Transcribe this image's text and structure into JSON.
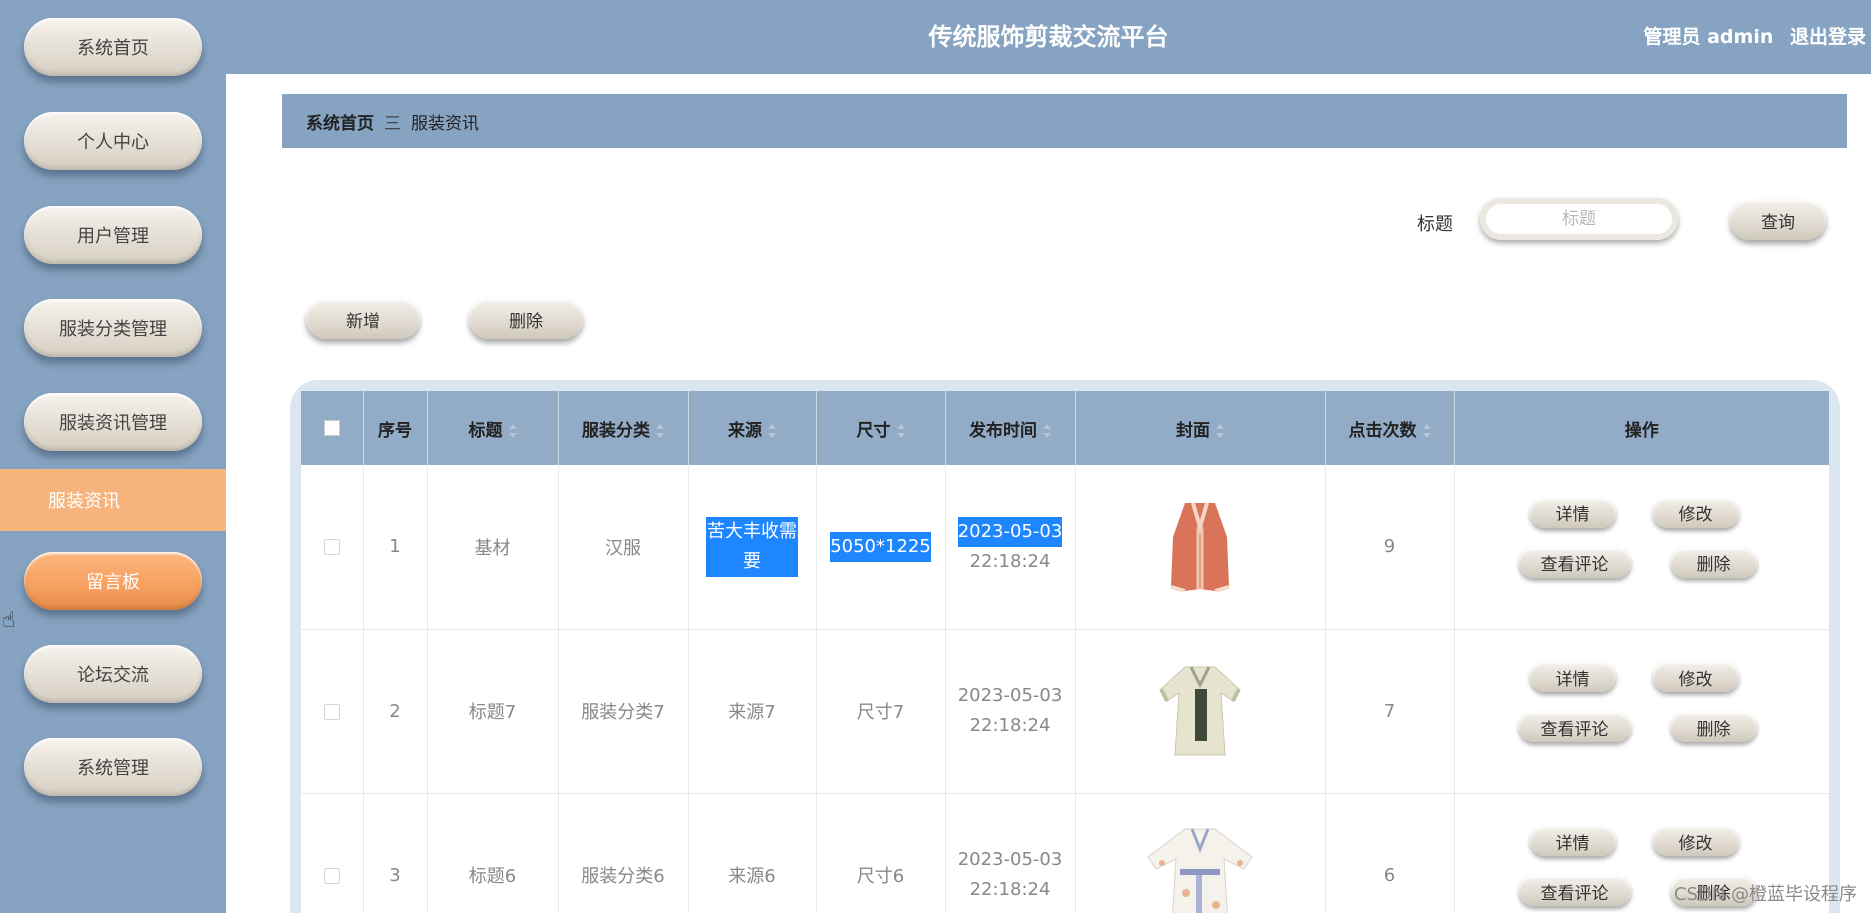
{
  "sidebar": {
    "items": [
      {
        "label": "系统首页"
      },
      {
        "label": "个人中心"
      },
      {
        "label": "用户管理"
      },
      {
        "label": "服装分类管理"
      },
      {
        "label": "服装资讯管理"
      }
    ],
    "active_item": {
      "label": "服装资讯"
    },
    "highlight_item": {
      "label": "留言板"
    },
    "items_after": [
      {
        "label": "论坛交流"
      },
      {
        "label": "系统管理"
      }
    ]
  },
  "header": {
    "title": "传统服饰剪裁交流平台",
    "user": "管理员 admin",
    "logout": "退出登录"
  },
  "breadcrumb": {
    "home": "系统首页",
    "separator": "三",
    "current": "服装资讯"
  },
  "search": {
    "label": "标题",
    "placeholder": "标题",
    "button": "查询"
  },
  "actions": {
    "add": "新增",
    "delete": "删除"
  },
  "table": {
    "columns": [
      "序号",
      "标题",
      "服装分类",
      "来源",
      "尺寸",
      "发布时间",
      "封面",
      "点击次数",
      "操作"
    ],
    "rows": [
      {
        "index": "1",
        "title": "基材",
        "category": "汉服",
        "source": "苦大丰收需要",
        "size": "5050*1225",
        "date": "2023-05-03",
        "time": "22:18:24",
        "cover": "red-robe",
        "clicks": "9"
      },
      {
        "index": "2",
        "title": "标题7",
        "category": "服装分类7",
        "source": "来源7",
        "size": "尺寸7",
        "date": "2023-05-03",
        "time": "22:18:24",
        "cover": "green-hanfu",
        "clicks": "7"
      },
      {
        "index": "3",
        "title": "标题6",
        "category": "服装分类6",
        "source": "来源6",
        "size": "尺寸6",
        "date": "2023-05-03",
        "time": "22:18:24",
        "cover": "white-floral-robe",
        "clicks": "6"
      }
    ],
    "ops": {
      "detail": "详情",
      "edit": "修改",
      "comments": "查看评论",
      "delete": "删除"
    }
  },
  "watermark": "CSDN @橙蓝毕设程序",
  "colors": {
    "sidebar": "#86a3c1",
    "header": "#86a3c1",
    "active_nav": "#f6b47c",
    "table_header": "#92abc6",
    "selection": "#1e86ff"
  }
}
